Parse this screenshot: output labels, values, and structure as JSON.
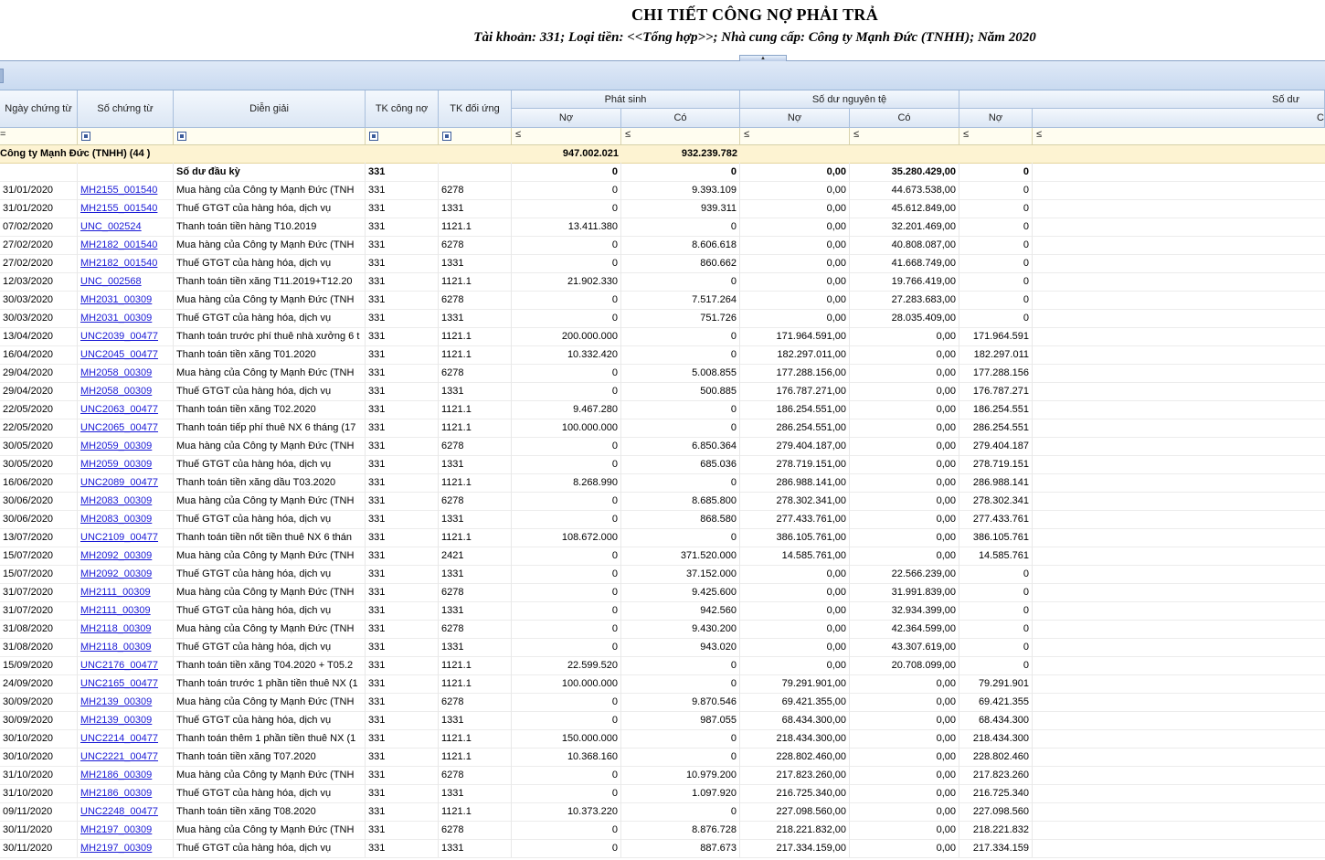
{
  "report": {
    "title": "CHI TIẾT CÔNG NỢ PHẢI TRẢ",
    "subtitle": "Tài khoản: 331; Loại tiền: <<Tổng hợp>>; Nhà cung cấp: Công ty Mạnh Đức (TNHH); Năm 2020"
  },
  "columns": {
    "ngay": "Ngày chứng từ",
    "so_ct": "Số chứng từ",
    "dien_giai": "Diễn giải",
    "tk_cong_no": "TK công nợ",
    "tk_doi_ung": "TK đối ứng",
    "phat_sinh": "Phát sinh",
    "so_du_nguyen_te": "Số dư nguyên tệ",
    "so_du": "Số dư",
    "no": "Nợ",
    "co": "Có",
    "co_partial": "C"
  },
  "filter": {
    "op": "≤",
    "first": "="
  },
  "group": {
    "label": "Công ty Mạnh Đức (TNHH) (44 )",
    "ps_no": "947.002.021",
    "ps_co": "932.239.782"
  },
  "opening": {
    "label": "Số dư đầu kỳ",
    "tk": "331",
    "ps_no": "0",
    "ps_co": "0",
    "nt_no": "0,00",
    "nt_co": "35.280.429,00",
    "sd_no": "0"
  },
  "rows": [
    {
      "date": "31/01/2020",
      "doc": "MH2155_001540",
      "desc": "Mua hàng của Công ty Mạnh Đức (TNH",
      "tk": "331",
      "tkdu": "6278",
      "ps_no": "0",
      "ps_co": "9.393.109",
      "nt_no": "0,00",
      "nt_co": "44.673.538,00",
      "sd_no": "0"
    },
    {
      "date": "31/01/2020",
      "doc": "MH2155_001540",
      "desc": "Thuế GTGT của hàng hóa, dịch vụ",
      "tk": "331",
      "tkdu": "1331",
      "ps_no": "0",
      "ps_co": "939.311",
      "nt_no": "0,00",
      "nt_co": "45.612.849,00",
      "sd_no": "0"
    },
    {
      "date": "07/02/2020",
      "doc": "UNC_002524",
      "desc": "Thanh toán tiền hàng T10.2019",
      "tk": "331",
      "tkdu": "1121.1",
      "ps_no": "13.411.380",
      "ps_co": "0",
      "nt_no": "0,00",
      "nt_co": "32.201.469,00",
      "sd_no": "0"
    },
    {
      "date": "27/02/2020",
      "doc": "MH2182_001540",
      "desc": "Mua hàng của Công ty Mạnh Đức (TNH",
      "tk": "331",
      "tkdu": "6278",
      "ps_no": "0",
      "ps_co": "8.606.618",
      "nt_no": "0,00",
      "nt_co": "40.808.087,00",
      "sd_no": "0"
    },
    {
      "date": "27/02/2020",
      "doc": "MH2182_001540",
      "desc": "Thuế GTGT của hàng hóa, dịch vụ",
      "tk": "331",
      "tkdu": "1331",
      "ps_no": "0",
      "ps_co": "860.662",
      "nt_no": "0,00",
      "nt_co": "41.668.749,00",
      "sd_no": "0"
    },
    {
      "date": "12/03/2020",
      "doc": "UNC_002568",
      "desc": "Thanh toán tiền xăng T11.2019+T12.20",
      "tk": "331",
      "tkdu": "1121.1",
      "ps_no": "21.902.330",
      "ps_co": "0",
      "nt_no": "0,00",
      "nt_co": "19.766.419,00",
      "sd_no": "0"
    },
    {
      "date": "30/03/2020",
      "doc": "MH2031_00309",
      "desc": "Mua hàng của Công ty Mạnh Đức (TNH",
      "tk": "331",
      "tkdu": "6278",
      "ps_no": "0",
      "ps_co": "7.517.264",
      "nt_no": "0,00",
      "nt_co": "27.283.683,00",
      "sd_no": "0"
    },
    {
      "date": "30/03/2020",
      "doc": "MH2031_00309",
      "desc": "Thuế GTGT của hàng hóa, dịch vụ",
      "tk": "331",
      "tkdu": "1331",
      "ps_no": "0",
      "ps_co": "751.726",
      "nt_no": "0,00",
      "nt_co": "28.035.409,00",
      "sd_no": "0"
    },
    {
      "date": "13/04/2020",
      "doc": "UNC2039_00477",
      "desc": "Thanh toán trước phí thuê nhà xưởng 6 t",
      "tk": "331",
      "tkdu": "1121.1",
      "ps_no": "200.000.000",
      "ps_co": "0",
      "nt_no": "171.964.591,00",
      "nt_co": "0,00",
      "sd_no": "171.964.591"
    },
    {
      "date": "16/04/2020",
      "doc": "UNC2045_00477",
      "desc": "Thanh toán tiền xăng T01.2020",
      "tk": "331",
      "tkdu": "1121.1",
      "ps_no": "10.332.420",
      "ps_co": "0",
      "nt_no": "182.297.011,00",
      "nt_co": "0,00",
      "sd_no": "182.297.011"
    },
    {
      "date": "29/04/2020",
      "doc": "MH2058_00309",
      "desc": "Mua hàng của Công ty Mạnh Đức (TNH",
      "tk": "331",
      "tkdu": "6278",
      "ps_no": "0",
      "ps_co": "5.008.855",
      "nt_no": "177.288.156,00",
      "nt_co": "0,00",
      "sd_no": "177.288.156"
    },
    {
      "date": "29/04/2020",
      "doc": "MH2058_00309",
      "desc": "Thuế GTGT của hàng hóa, dịch vụ",
      "tk": "331",
      "tkdu": "1331",
      "ps_no": "0",
      "ps_co": "500.885",
      "nt_no": "176.787.271,00",
      "nt_co": "0,00",
      "sd_no": "176.787.271"
    },
    {
      "date": "22/05/2020",
      "doc": "UNC2063_00477",
      "desc": "Thanh toán tiền xăng T02.2020",
      "tk": "331",
      "tkdu": "1121.1",
      "ps_no": "9.467.280",
      "ps_co": "0",
      "nt_no": "186.254.551,00",
      "nt_co": "0,00",
      "sd_no": "186.254.551"
    },
    {
      "date": "22/05/2020",
      "doc": "UNC2065_00477",
      "desc": "Thanh toán tiếp phí thuê NX 6 tháng (17",
      "tk": "331",
      "tkdu": "1121.1",
      "ps_no": "100.000.000",
      "ps_co": "0",
      "nt_no": "286.254.551,00",
      "nt_co": "0,00",
      "sd_no": "286.254.551"
    },
    {
      "date": "30/05/2020",
      "doc": "MH2059_00309",
      "desc": "Mua hàng của Công ty Mạnh Đức (TNH",
      "tk": "331",
      "tkdu": "6278",
      "ps_no": "0",
      "ps_co": "6.850.364",
      "nt_no": "279.404.187,00",
      "nt_co": "0,00",
      "sd_no": "279.404.187"
    },
    {
      "date": "30/05/2020",
      "doc": "MH2059_00309",
      "desc": "Thuế GTGT của hàng hóa, dịch vụ",
      "tk": "331",
      "tkdu": "1331",
      "ps_no": "0",
      "ps_co": "685.036",
      "nt_no": "278.719.151,00",
      "nt_co": "0,00",
      "sd_no": "278.719.151"
    },
    {
      "date": "16/06/2020",
      "doc": "UNC2089_00477",
      "desc": "Thanh toán tiền xăng dầu T03.2020",
      "tk": "331",
      "tkdu": "1121.1",
      "ps_no": "8.268.990",
      "ps_co": "0",
      "nt_no": "286.988.141,00",
      "nt_co": "0,00",
      "sd_no": "286.988.141"
    },
    {
      "date": "30/06/2020",
      "doc": "MH2083_00309",
      "desc": "Mua hàng của Công ty Mạnh Đức (TNH",
      "tk": "331",
      "tkdu": "6278",
      "ps_no": "0",
      "ps_co": "8.685.800",
      "nt_no": "278.302.341,00",
      "nt_co": "0,00",
      "sd_no": "278.302.341"
    },
    {
      "date": "30/06/2020",
      "doc": "MH2083_00309",
      "desc": "Thuế GTGT của hàng hóa, dịch vụ",
      "tk": "331",
      "tkdu": "1331",
      "ps_no": "0",
      "ps_co": "868.580",
      "nt_no": "277.433.761,00",
      "nt_co": "0,00",
      "sd_no": "277.433.761"
    },
    {
      "date": "13/07/2020",
      "doc": "UNC2109_00477",
      "desc": "Thanh toán tiền nốt tiền thuê NX 6 thán",
      "tk": "331",
      "tkdu": "1121.1",
      "ps_no": "108.672.000",
      "ps_co": "0",
      "nt_no": "386.105.761,00",
      "nt_co": "0,00",
      "sd_no": "386.105.761"
    },
    {
      "date": "15/07/2020",
      "doc": "MH2092_00309",
      "desc": "Mua hàng của Công ty Mạnh Đức (TNH",
      "tk": "331",
      "tkdu": "2421",
      "ps_no": "0",
      "ps_co": "371.520.000",
      "nt_no": "14.585.761,00",
      "nt_co": "0,00",
      "sd_no": "14.585.761"
    },
    {
      "date": "15/07/2020",
      "doc": "MH2092_00309",
      "desc": "Thuế GTGT của hàng hóa, dịch vụ",
      "tk": "331",
      "tkdu": "1331",
      "ps_no": "0",
      "ps_co": "37.152.000",
      "nt_no": "0,00",
      "nt_co": "22.566.239,00",
      "sd_no": "0"
    },
    {
      "date": "31/07/2020",
      "doc": "MH2111_00309",
      "desc": "Mua hàng của Công ty Mạnh Đức (TNH",
      "tk": "331",
      "tkdu": "6278",
      "ps_no": "0",
      "ps_co": "9.425.600",
      "nt_no": "0,00",
      "nt_co": "31.991.839,00",
      "sd_no": "0"
    },
    {
      "date": "31/07/2020",
      "doc": "MH2111_00309",
      "desc": "Thuế GTGT của hàng hóa, dịch vụ",
      "tk": "331",
      "tkdu": "1331",
      "ps_no": "0",
      "ps_co": "942.560",
      "nt_no": "0,00",
      "nt_co": "32.934.399,00",
      "sd_no": "0"
    },
    {
      "date": "31/08/2020",
      "doc": "MH2118_00309",
      "desc": "Mua hàng của Công ty Mạnh Đức (TNH",
      "tk": "331",
      "tkdu": "6278",
      "ps_no": "0",
      "ps_co": "9.430.200",
      "nt_no": "0,00",
      "nt_co": "42.364.599,00",
      "sd_no": "0"
    },
    {
      "date": "31/08/2020",
      "doc": "MH2118_00309",
      "desc": "Thuế GTGT của hàng hóa, dịch vụ",
      "tk": "331",
      "tkdu": "1331",
      "ps_no": "0",
      "ps_co": "943.020",
      "nt_no": "0,00",
      "nt_co": "43.307.619,00",
      "sd_no": "0"
    },
    {
      "date": "15/09/2020",
      "doc": "UNC2176_00477",
      "desc": "Thanh toán tiền xăng T04.2020 + T05.2",
      "tk": "331",
      "tkdu": "1121.1",
      "ps_no": "22.599.520",
      "ps_co": "0",
      "nt_no": "0,00",
      "nt_co": "20.708.099,00",
      "sd_no": "0"
    },
    {
      "date": "24/09/2020",
      "doc": "UNC2165_00477",
      "desc": "Thanh toán trước 1 phần tiền thuê NX (1",
      "tk": "331",
      "tkdu": "1121.1",
      "ps_no": "100.000.000",
      "ps_co": "0",
      "nt_no": "79.291.901,00",
      "nt_co": "0,00",
      "sd_no": "79.291.901"
    },
    {
      "date": "30/09/2020",
      "doc": "MH2139_00309",
      "desc": "Mua hàng của Công ty Mạnh Đức (TNH",
      "tk": "331",
      "tkdu": "6278",
      "ps_no": "0",
      "ps_co": "9.870.546",
      "nt_no": "69.421.355,00",
      "nt_co": "0,00",
      "sd_no": "69.421.355"
    },
    {
      "date": "30/09/2020",
      "doc": "MH2139_00309",
      "desc": "Thuế GTGT của hàng hóa, dịch vụ",
      "tk": "331",
      "tkdu": "1331",
      "ps_no": "0",
      "ps_co": "987.055",
      "nt_no": "68.434.300,00",
      "nt_co": "0,00",
      "sd_no": "68.434.300"
    },
    {
      "date": "30/10/2020",
      "doc": "UNC2214_00477",
      "desc": "Thanh toán thêm 1 phần tiền thuê NX (1",
      "tk": "331",
      "tkdu": "1121.1",
      "ps_no": "150.000.000",
      "ps_co": "0",
      "nt_no": "218.434.300,00",
      "nt_co": "0,00",
      "sd_no": "218.434.300"
    },
    {
      "date": "30/10/2020",
      "doc": "UNC2221_00477",
      "desc": "Thanh toán tiền xăng T07.2020",
      "tk": "331",
      "tkdu": "1121.1",
      "ps_no": "10.368.160",
      "ps_co": "0",
      "nt_no": "228.802.460,00",
      "nt_co": "0,00",
      "sd_no": "228.802.460"
    },
    {
      "date": "31/10/2020",
      "doc": "MH2186_00309",
      "desc": "Mua hàng của Công ty Mạnh Đức (TNH",
      "tk": "331",
      "tkdu": "6278",
      "ps_no": "0",
      "ps_co": "10.979.200",
      "nt_no": "217.823.260,00",
      "nt_co": "0,00",
      "sd_no": "217.823.260"
    },
    {
      "date": "31/10/2020",
      "doc": "MH2186_00309",
      "desc": "Thuế GTGT của hàng hóa, dịch vụ",
      "tk": "331",
      "tkdu": "1331",
      "ps_no": "0",
      "ps_co": "1.097.920",
      "nt_no": "216.725.340,00",
      "nt_co": "0,00",
      "sd_no": "216.725.340"
    },
    {
      "date": "09/11/2020",
      "doc": "UNC2248_00477",
      "desc": "Thanh toán tiền xăng T08.2020",
      "tk": "331",
      "tkdu": "1121.1",
      "ps_no": "10.373.220",
      "ps_co": "0",
      "nt_no": "227.098.560,00",
      "nt_co": "0,00",
      "sd_no": "227.098.560"
    },
    {
      "date": "30/11/2020",
      "doc": "MH2197_00309",
      "desc": "Mua hàng của Công ty Mạnh Đức (TNH",
      "tk": "331",
      "tkdu": "6278",
      "ps_no": "0",
      "ps_co": "8.876.728",
      "nt_no": "218.221.832,00",
      "nt_co": "0,00",
      "sd_no": "218.221.832"
    },
    {
      "date": "30/11/2020",
      "doc": "MH2197_00309",
      "desc": "Thuế GTGT của hàng hóa, dịch vụ",
      "tk": "331",
      "tkdu": "1331",
      "ps_no": "0",
      "ps_co": "887.673",
      "nt_no": "217.334.159,00",
      "nt_co": "0,00",
      "sd_no": "217.334.159"
    }
  ]
}
